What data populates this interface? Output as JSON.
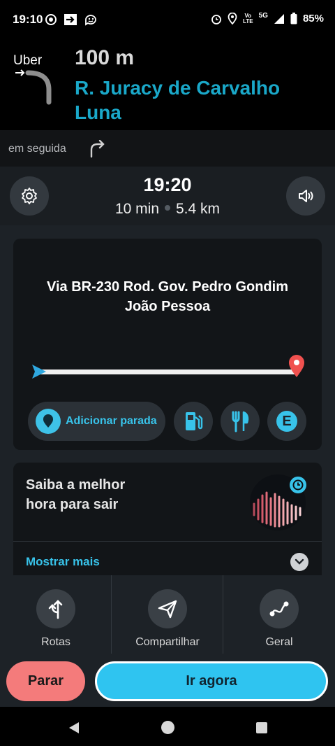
{
  "status_bar": {
    "time": "19:10",
    "battery": "85%",
    "network": "5G",
    "volte_top": "Vo",
    "volte_bottom": "LTE",
    "icons": [
      "target-icon",
      "forward-arrow-icon",
      "waze-icon",
      "alarm-icon",
      "location-pin-icon",
      "signal-icon",
      "battery-icon"
    ]
  },
  "instruction": {
    "brand": "Uber",
    "distance": "100 m",
    "street": "R. Juracy de Carvalho Luna",
    "next_label": "em seguida",
    "turn_icon": "turn-left-arrow-icon",
    "next_icon": "turn-right-arrow-icon"
  },
  "trip": {
    "arrival_time": "19:20",
    "duration": "10 min",
    "distance": "5.4 km",
    "settings_icon": "gear-icon",
    "sound_icon": "speaker-icon"
  },
  "route": {
    "title_line1": "Via BR-230 Rod. Gov. Pedro Gondim",
    "title_line2": "João Pessoa",
    "progress": 0.0,
    "add_stop_label": "Adicionar parada",
    "gas_icon": "gas-station-icon",
    "food_icon": "fork-knife-icon",
    "parking_letter": "E",
    "colors": {
      "accent": "#38c3ea",
      "destination": "#f0514f",
      "start": "#2fa8e0"
    }
  },
  "best_time": {
    "line1": "Saiba a melhor",
    "line2": "hora para sair",
    "show_more": "Mostrar mais",
    "icon": "clock-icon"
  },
  "tabs": [
    {
      "label": "Rotas",
      "icon": "routes-icon"
    },
    {
      "label": "Compartilhar",
      "icon": "send-icon"
    },
    {
      "label": "Geral",
      "icon": "overview-path-icon"
    }
  ],
  "actions": {
    "stop": "Parar",
    "go": "Ir agora",
    "colors": {
      "stop": "#f47b7b",
      "go": "#2fc4f0"
    }
  },
  "system_nav": [
    "back-icon",
    "home-icon",
    "recents-icon"
  ]
}
